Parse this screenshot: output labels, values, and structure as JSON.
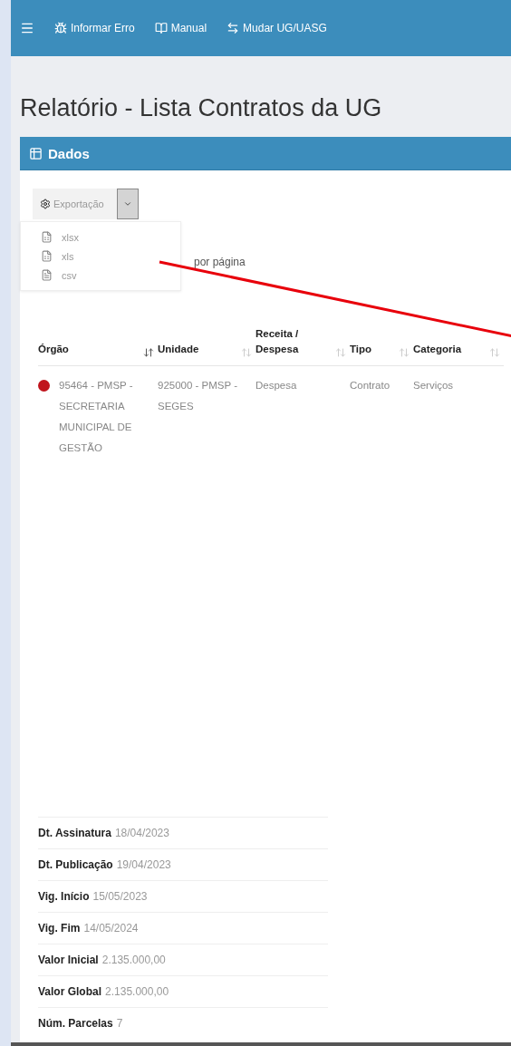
{
  "topbar": {
    "links": [
      {
        "label": "Informar Erro",
        "kind": "bug"
      },
      {
        "label": "Manual",
        "kind": "book"
      },
      {
        "label": "Mudar UG/UASG",
        "kind": "swap"
      }
    ]
  },
  "title": "Relatório - Lista Contratos da UG",
  "panel": {
    "title": "Dados",
    "export": {
      "label": "Exportação",
      "expanded": true,
      "items": [
        {
          "label": "xlsx",
          "kind": "spreadsheet"
        },
        {
          "label": "xls",
          "kind": "spreadsheet"
        },
        {
          "label": "csv",
          "kind": "text"
        }
      ]
    },
    "per_page": "por página",
    "table": {
      "columns": [
        {
          "label": "Órgão",
          "sorted": true
        },
        {
          "label": "Unidade",
          "sorted": false
        },
        {
          "label": "Receita / Despesa",
          "sorted": false
        },
        {
          "label": "Tipo",
          "sorted": false
        },
        {
          "label": "Categoria",
          "sorted": false
        }
      ],
      "rows": [
        {
          "color": "#c0141c",
          "cells": [
            "95464 - PMSP - SECRETARIA MUNICIPAL DE GESTÃO",
            "925000 - PMSP - SEGES",
            "Despesa",
            "Contrato",
            "Serviços"
          ]
        }
      ]
    },
    "details": [
      {
        "label": "Dt. Assinatura",
        "value": "18/04/2023"
      },
      {
        "label": "Dt. Publicação",
        "value": "19/04/2023"
      },
      {
        "label": "Vig. Início",
        "value": "15/05/2023"
      },
      {
        "label": "Vig. Fim",
        "value": "14/05/2024"
      },
      {
        "label": "Valor Inicial",
        "value": "2.135.000,00"
      },
      {
        "label": "Valor Global",
        "value": "2.135.000,00"
      },
      {
        "label": "Núm. Parcelas",
        "value": "7"
      }
    ]
  }
}
